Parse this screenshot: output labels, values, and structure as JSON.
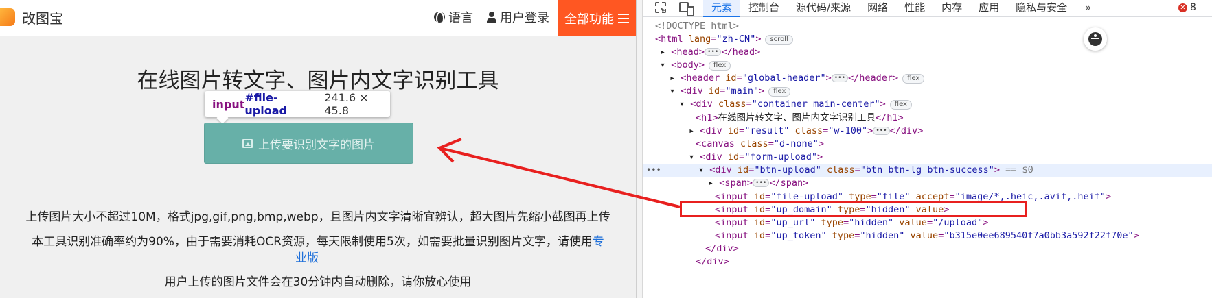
{
  "site": {
    "logo_text": "改图宝",
    "nav_language": "语言",
    "nav_login": "用户登录",
    "nav_all": "全部功能",
    "title": "在线图片转文字、图片内文字识别工具",
    "upload_button": "上传要识别文字的图片",
    "tooltip": {
      "tag": "input",
      "id": "#file-upload",
      "size": "241.6 × 45.8"
    },
    "info_1": "上传图片大小不超过10M，格式jpg,gif,png,bmp,webp，且图片内文字清晰宜辨认，超大图片先缩小截图再上传",
    "info_2": "本工具识别准确率约为90%，由于需要消耗OCR资源，每天限制使用5次，如需要批量识别图片文字，请使用",
    "info_2_link_a": "专",
    "info_2_link_b": "业版",
    "info_3": "用户上传的图片文件会在30分钟内自动删除，请你放心使用"
  },
  "devtools": {
    "tabs": [
      "元素",
      "控制台",
      "源代码/来源",
      "网络",
      "性能",
      "内存",
      "应用",
      "隐私与安全"
    ],
    "more": "»",
    "error_count": "8",
    "error_symbol": "✕",
    "lines": {
      "l0": "<!DOCTYPE html>",
      "l1_tag_open": "<html",
      "l1_attr": " lang",
      "l1_val": "\"zh-CN\"",
      "l1_close": ">",
      "l1_pill": "scroll",
      "l2_a": "<head>",
      "l2_b": "</head>",
      "l3": "<body>",
      "l3_pill": "flex",
      "l4_open": "<header",
      "l4_attr": " id",
      "l4_val": "\"global-header\"",
      "l4_mid": ">",
      "l4_end": "</header>",
      "l4_pill": "flex",
      "l5_open": "<div",
      "l5_attr": " id",
      "l5_val": "\"main\"",
      "l5_close": ">",
      "l5_pill": "flex",
      "l6_open": "<div",
      "l6_attr": " class",
      "l6_val": "\"container main-center\"",
      "l6_close": ">",
      "l6_pill": "flex",
      "l7_open": "<h1>",
      "l7_text": "在线图片转文字、图片内文字识别工具",
      "l7_close": "</h1>",
      "l8_open": "<div",
      "l8_attr1": " id",
      "l8_val1": "\"result\"",
      "l8_attr2": " class",
      "l8_val2": "\"w-100\"",
      "l8_mid": ">",
      "l8_end": "</div>",
      "l9_open": "<canvas",
      "l9_attr": " class",
      "l9_val": "\"d-none\"",
      "l9_close": ">",
      "l10_open": "<div",
      "l10_attr": " id",
      "l10_val": "\"form-upload\"",
      "l10_close": ">",
      "l11_open": "<div",
      "l11_attr1": " id",
      "l11_val1": "\"btn-upload\"",
      "l11_attr2": " class",
      "l11_val2": "\"btn btn-lg btn-success\"",
      "l11_close": ">",
      "l11_comment": " == $0",
      "l12_a": "<span>",
      "l12_b": "</span>",
      "l13_open": "<input",
      "l13_attr1": " id",
      "l13_val1": "\"file-upload\"",
      "l13_attr2": " type",
      "l13_val2": "\"file\"",
      "l13_attr3": " accept",
      "l13_val3": "\"image/*,.heic,.avif,.heif\"",
      "l13_close": ">",
      "l14_open": "<input",
      "l14_attr1": " id",
      "l14_val1": "\"up_domain\"",
      "l14_attr2": " type",
      "l14_val2": "\"hidden\"",
      "l14_attr3": " value",
      "l14_close": ">",
      "l15_open": "<input",
      "l15_attr1": " id",
      "l15_val1": "\"up_url\"",
      "l15_attr2": " type",
      "l15_val2": "\"hidden\"",
      "l15_attr3": " value",
      "l15_val3": "\"/upload\"",
      "l15_close": ">",
      "l16_open": "<input",
      "l16_attr1": " id",
      "l16_val1": "\"up_token\"",
      "l16_attr2": " type",
      "l16_val2": "\"hidden\"",
      "l16_attr3": " value",
      "l16_val3": "\"b315e0ee689540f7a0bb3a592f22f70e\"",
      "l16_close": ">",
      "l17": "</div>",
      "l18": "</div>"
    },
    "gutter_dots": "•••",
    "expand_dots": "•••"
  },
  "colors": {
    "accent": "#ff5722",
    "button": "#67b0a8",
    "devtools_blue": "#1a73e8",
    "highlight_red": "#e8201f"
  }
}
